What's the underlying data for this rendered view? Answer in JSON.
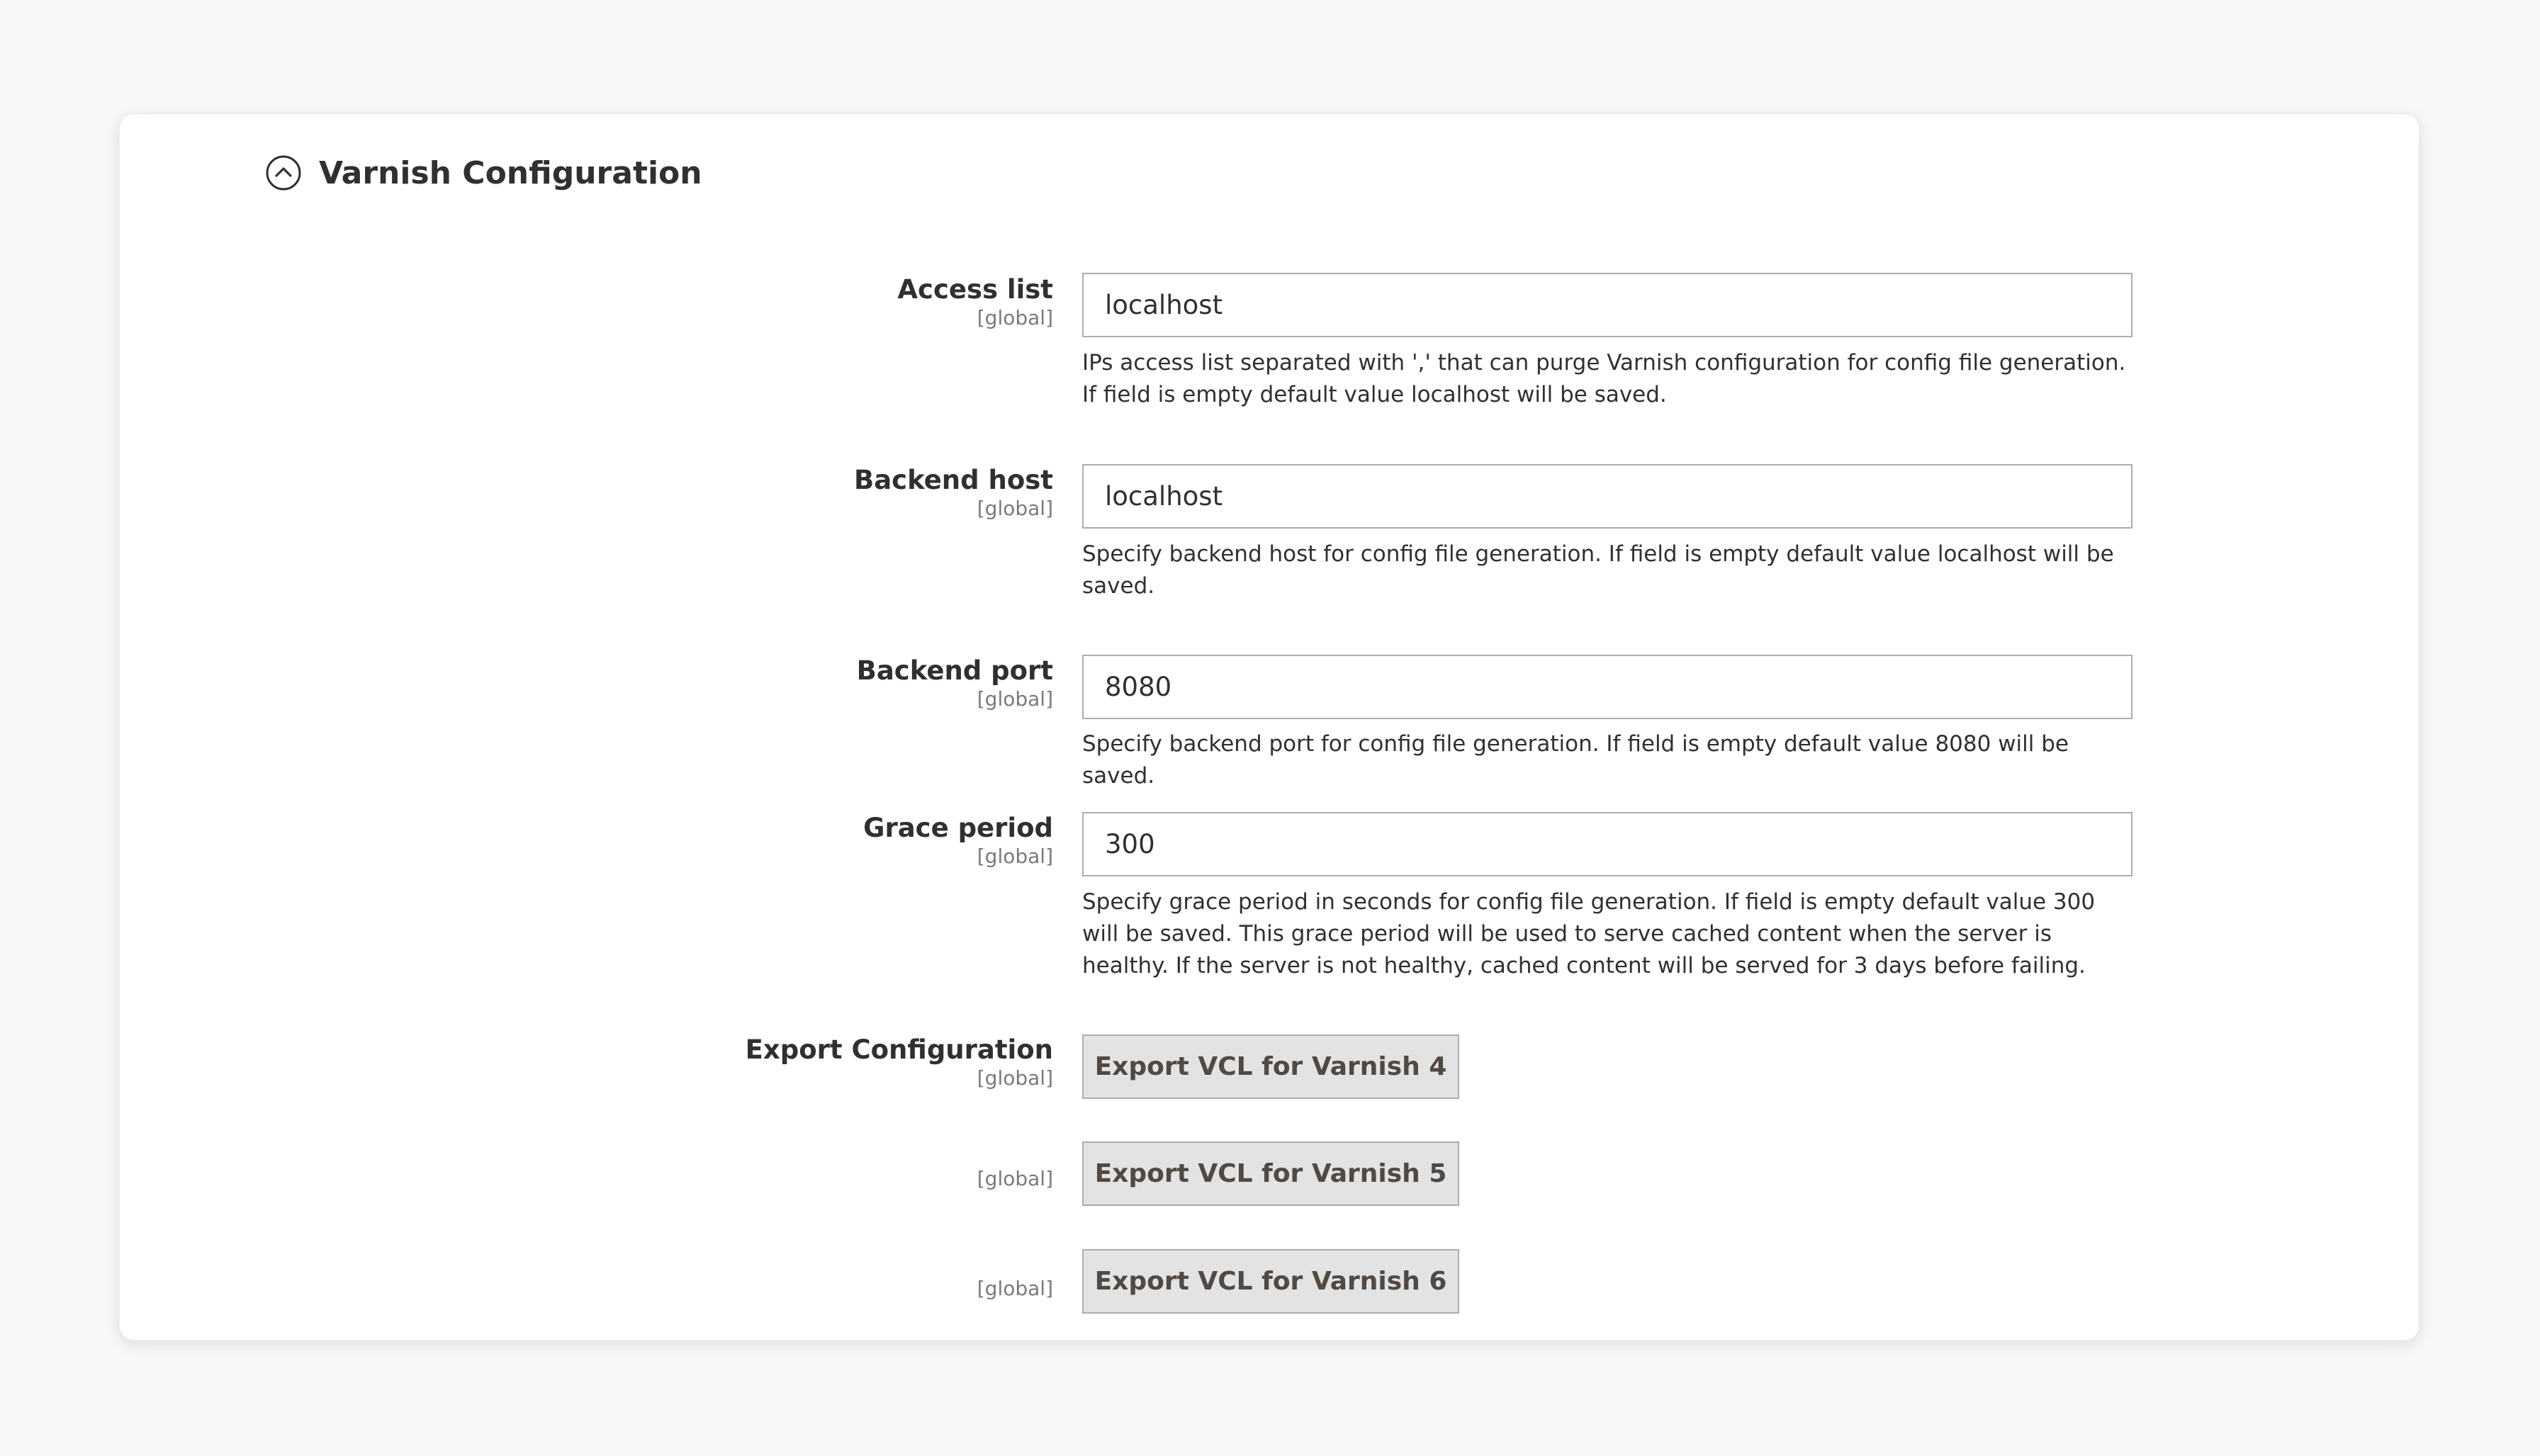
{
  "section": {
    "title": "Varnish Configuration",
    "icon": "collapse-circle-up-icon"
  },
  "fields": {
    "access_list": {
      "label": "Access list",
      "scope": "[global]",
      "value": "localhost",
      "note": "IPs access list separated with ',' that can purge Varnish configuration for config file generation. If field is empty default value localhost will be saved."
    },
    "backend_host": {
      "label": "Backend host",
      "scope": "[global]",
      "value": "localhost",
      "note": "Specify backend host for config file generation. If field is empty default value localhost will be saved."
    },
    "backend_port": {
      "label": "Backend port",
      "scope": "[global]",
      "value": "8080",
      "note": "Specify backend port for config file generation. If field is empty default value 8080 will be saved."
    },
    "grace_period": {
      "label": "Grace period",
      "scope": "[global]",
      "value": "300",
      "note": "Specify grace period in seconds for config file generation. If field is empty default value 300 will be saved. This grace period will be used to serve cached content when the server is healthy. If the server is not healthy, cached content will be served for 3 days before failing."
    }
  },
  "export": {
    "label": "Export Configuration",
    "scope": "[global]",
    "buttons": [
      {
        "label": "Export VCL for Varnish 4",
        "scope": "[global]"
      },
      {
        "label": "Export VCL for Varnish 5",
        "scope": "[global]"
      },
      {
        "label": "Export VCL for Varnish 6",
        "scope": "[global]"
      }
    ]
  },
  "colors": {
    "page_bg": "#f8f8f8",
    "card_bg": "#ffffff",
    "text": "#303030",
    "muted": "#7a7a7a",
    "input_border": "#adadad",
    "button_bg": "#e3e3e3",
    "button_text": "#514943"
  }
}
